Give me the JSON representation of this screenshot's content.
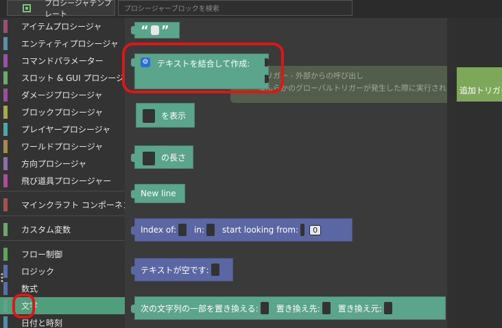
{
  "tabs": {
    "templates": "プロシージャテンプレート",
    "search_placeholder": "プロシージャーブロックを検索"
  },
  "categories": [
    {
      "label": "アイテムプロシージャ",
      "color": "#9b4f76"
    },
    {
      "label": "エンティティプロシージャ",
      "color": "#5a8fa8"
    },
    {
      "label": "コマンドパラメーター",
      "color": "#9b4fa8"
    },
    {
      "label": "スロット & GUI プロシージャ",
      "color": "#6fa86f"
    },
    {
      "label": "ダメージプロシージャ",
      "color": "#9b4f9b"
    },
    {
      "label": "ブロックプロシージャ",
      "color": "#a8a84f"
    },
    {
      "label": "プレイヤープロシージャ",
      "color": "#4fa8a8"
    },
    {
      "label": "ワールドプロシージャ",
      "color": "#a88a4f"
    },
    {
      "label": "方向プロシージャ",
      "color": "#8a6fa8"
    },
    {
      "label": "飛び道具プロシージャー",
      "color": "#a84f9b"
    },
    {
      "label": "マインクラフト コンポーネント",
      "color": "#a84f4f"
    },
    {
      "label": "カスタム変数",
      "color": "#6fa86f"
    },
    {
      "label": "フロー制御",
      "color": "#5aa85a"
    },
    {
      "label": "ロジック",
      "color": "#5a6fa8"
    },
    {
      "label": "数式",
      "color": "#5a6fa8"
    },
    {
      "label": "文字",
      "color": "#5ba58c"
    },
    {
      "label": "日付と時刻",
      "color": "#4f8fa8"
    }
  ],
  "blocks": {
    "quote_open": "“",
    "quote_close": "”",
    "join": "テキストを結合して作成:",
    "print": "を表示",
    "length": "の長さ",
    "newline": "New line",
    "index_of": "Index of:",
    "in": "in:",
    "start_from": "start looking from:",
    "start_value": "0",
    "is_empty": "テキストが空です:",
    "replace": "次の文字列の一部を置き換える:",
    "replace_with": "置き換え先:",
    "replace_from": "置き換え元:"
  },
  "ghost": {
    "line1": "トリガー - 外部からの呼び出し",
    "line2": "なんらかのグローバルトリガーが発生した際に実行される"
  },
  "trigger_label": "追加トリガー",
  "colors": {
    "text_block": "#5ba58c",
    "index_block": "#5b67a5",
    "highlight": "#e01515"
  }
}
